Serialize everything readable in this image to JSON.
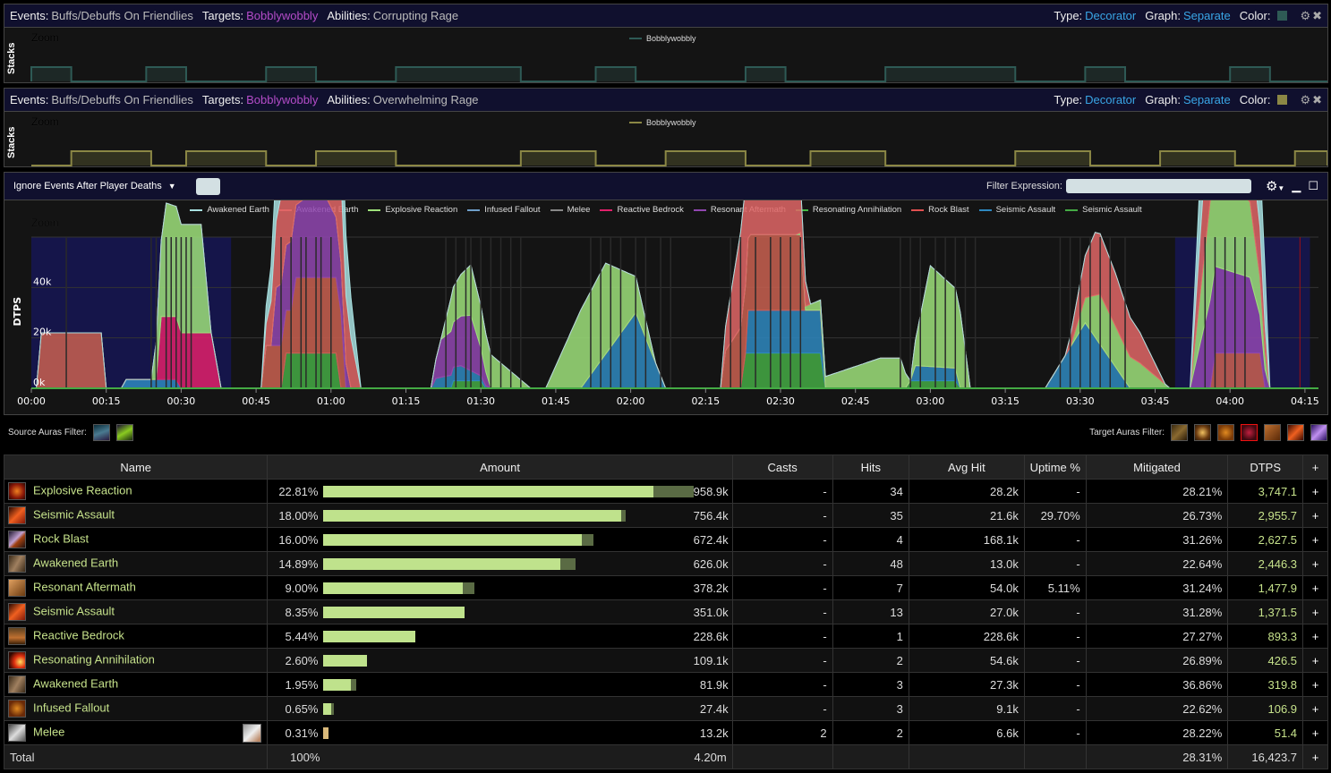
{
  "decorators": [
    {
      "events_label": "Events:",
      "events_value": "Buffs/Debuffs On Friendlies",
      "targets_label": "Targets:",
      "targets_value": "Bobblywobbly",
      "abilities_label": "Abilities:",
      "abilities_value": "Corrupting Rage",
      "type_label": "Type:",
      "type_value": "Decorator",
      "graph_label": "Graph:",
      "graph_value": "Separate",
      "color_label": "Color:",
      "color": "#2e5a55",
      "zoom_label": "Zoom",
      "ylabel": "Stacks",
      "legend": "Bobblywobbly",
      "active_intervals_s": [
        [
          0,
          8
        ],
        [
          23,
          31
        ],
        [
          47,
          57
        ],
        [
          73,
          98
        ],
        [
          113,
          121
        ],
        [
          143,
          151
        ],
        [
          171,
          197
        ],
        [
          211,
          219
        ],
        [
          240,
          248
        ]
      ]
    },
    {
      "events_label": "Events:",
      "events_value": "Buffs/Debuffs On Friendlies",
      "targets_label": "Targets:",
      "targets_value": "Bobblywobbly",
      "abilities_label": "Abilities:",
      "abilities_value": "Overwhelming Rage",
      "type_label": "Type:",
      "type_value": "Decorator",
      "graph_label": "Graph:",
      "graph_value": "Separate",
      "color_label": "Color:",
      "color": "#8b8745",
      "zoom_label": "Zoom",
      "ylabel": "Stacks",
      "legend": "Bobblywobbly",
      "active_intervals_s": [
        [
          8,
          24
        ],
        [
          31,
          47
        ],
        [
          57,
          73
        ],
        [
          98,
          113
        ],
        [
          127,
          143
        ],
        [
          156,
          171
        ],
        [
          197,
          212
        ],
        [
          226,
          241
        ],
        [
          253,
          262
        ]
      ]
    }
  ],
  "main_toolbar": {
    "death_filter": "Ignore Events After Player Deaths",
    "filter_label": "Filter Expression:",
    "filter_value": ""
  },
  "chart_data": {
    "type": "area",
    "stacked": true,
    "zoom_label": "Zoom",
    "ylabel": "DTPS",
    "xlabel": "",
    "ylim": [
      0,
      60000
    ],
    "yticks": [
      "0k",
      "20k",
      "40k"
    ],
    "xticks": [
      "00:00",
      "00:15",
      "00:30",
      "00:45",
      "01:00",
      "01:15",
      "01:30",
      "01:45",
      "02:00",
      "02:15",
      "02:30",
      "02:45",
      "03:00",
      "03:15",
      "03:30",
      "03:45",
      "04:00",
      "04:15"
    ],
    "xlim_s": [
      0,
      256
    ],
    "highlight_ranges_s": [
      [
        0,
        40
      ],
      [
        229,
        256
      ]
    ],
    "legend": [
      "Awakened Earth",
      "Awakened Earth",
      "Explosive Reaction",
      "Infused Fallout",
      "Melee",
      "Reactive Bedrock",
      "Resonant Aftermath",
      "Resonating Annihilation",
      "Rock Blast",
      "Seismic Assault",
      "Seismic Assault"
    ],
    "series_colors": [
      "#a8e0e0",
      "#e06666",
      "#9ee07a",
      "#6e9ec8",
      "#888888",
      "#e0206a",
      "#9046b0",
      "#44bb44",
      "#e05050",
      "#2e88c0",
      "#44aa44"
    ],
    "series": [
      {
        "name": "Seismic Assault (green)",
        "color": "#44aa44",
        "points": [
          [
            50,
            0
          ],
          [
            51,
            14000
          ],
          [
            61,
            14000
          ],
          [
            62,
            0
          ],
          [
            84,
            0
          ],
          [
            84,
            3000
          ],
          [
            90,
            3000
          ],
          [
            91,
            0
          ],
          [
            142,
            0
          ],
          [
            143,
            14000
          ],
          [
            158,
            14000
          ],
          [
            159,
            0
          ],
          [
            175,
            0
          ],
          [
            176,
            3000
          ],
          [
            185,
            3000
          ],
          [
            186,
            0
          ]
        ]
      },
      {
        "name": "Seismic Assault (blue)",
        "color": "#2e88c0",
        "points": [
          [
            18,
            0
          ],
          [
            19,
            3500
          ],
          [
            29,
            3500
          ],
          [
            30,
            0
          ],
          [
            80,
            0
          ],
          [
            81,
            4000
          ],
          [
            86,
            6000
          ],
          [
            92,
            0
          ],
          [
            110,
            0
          ],
          [
            121,
            30000
          ],
          [
            127,
            0
          ],
          [
            143,
            0
          ],
          [
            143,
            17000
          ],
          [
            158,
            17000
          ],
          [
            159,
            0
          ],
          [
            176,
            0
          ],
          [
            177,
            6000
          ],
          [
            185,
            5000
          ],
          [
            186,
            0
          ],
          [
            203,
            0
          ],
          [
            211,
            26000
          ],
          [
            220,
            0
          ]
        ]
      },
      {
        "name": "Reactive Bedrock",
        "color": "#e0206a",
        "points": [
          [
            25,
            0
          ],
          [
            26,
            25000
          ],
          [
            29,
            25000
          ],
          [
            30,
            22000
          ],
          [
            36,
            22000
          ],
          [
            38,
            0
          ]
        ]
      },
      {
        "name": "Rock Blast",
        "color": "#c96050",
        "points": [
          [
            1,
            0
          ],
          [
            2,
            22000
          ],
          [
            14,
            22000
          ],
          [
            15,
            0
          ],
          [
            46,
            0
          ],
          [
            47,
            17000
          ],
          [
            52,
            17000
          ],
          [
            53,
            30000
          ],
          [
            62,
            30000
          ],
          [
            63,
            0
          ],
          [
            138,
            0
          ],
          [
            139,
            15000
          ],
          [
            144,
            30000
          ],
          [
            154,
            30000
          ],
          [
            155,
            0
          ],
          [
            236,
            0
          ],
          [
            237,
            14000
          ],
          [
            246,
            14000
          ],
          [
            247,
            0
          ]
        ]
      },
      {
        "name": "Resonant Aftermath",
        "color": "#9046b0",
        "points": [
          [
            48,
            0
          ],
          [
            49,
            23000
          ],
          [
            58,
            36000
          ],
          [
            62,
            20000
          ],
          [
            64,
            0
          ],
          [
            80,
            0
          ],
          [
            82,
            15000
          ],
          [
            88,
            22000
          ],
          [
            92,
            0
          ],
          [
            232,
            0
          ],
          [
            236,
            35000
          ],
          [
            244,
            30000
          ],
          [
            248,
            0
          ]
        ]
      },
      {
        "name": "Explosive Reaction",
        "color": "#9ee07a",
        "points": [
          [
            24,
            0
          ],
          [
            27,
            45000
          ],
          [
            30,
            43000
          ],
          [
            34,
            43000
          ],
          [
            36,
            0
          ],
          [
            82,
            0
          ],
          [
            84,
            13000
          ],
          [
            88,
            20000
          ],
          [
            100,
            0
          ],
          [
            103,
            0
          ],
          [
            110,
            31000
          ],
          [
            115,
            36000
          ],
          [
            120,
            18000
          ],
          [
            125,
            0
          ],
          [
            153,
            0
          ],
          [
            158,
            4000
          ],
          [
            170,
            12000
          ],
          [
            174,
            12000
          ],
          [
            176,
            0
          ],
          [
            176,
            0
          ],
          [
            180,
            40000
          ],
          [
            186,
            30000
          ],
          [
            188,
            0
          ],
          [
            208,
            0
          ],
          [
            214,
            20000
          ],
          [
            222,
            10000
          ],
          [
            228,
            0
          ],
          [
            232,
            0
          ],
          [
            236,
            39000
          ],
          [
            244,
            30000
          ],
          [
            248,
            0
          ]
        ]
      },
      {
        "name": "Awakened Earth (red)",
        "color": "#e06666",
        "points": [
          [
            46,
            0
          ],
          [
            50,
            35000
          ],
          [
            53,
            48000
          ],
          [
            60,
            47000
          ],
          [
            64,
            20000
          ],
          [
            66,
            0
          ],
          [
            138,
            0
          ],
          [
            142,
            38000
          ],
          [
            148,
            43000
          ],
          [
            150,
            25000
          ],
          [
            154,
            20000
          ],
          [
            156,
            0
          ],
          [
            207,
            0
          ],
          [
            213,
            25000
          ],
          [
            217,
            21000
          ],
          [
            222,
            12000
          ],
          [
            227,
            0
          ],
          [
            232,
            0
          ],
          [
            236,
            45000
          ],
          [
            240,
            38000
          ],
          [
            246,
            20000
          ],
          [
            248,
            0
          ]
        ]
      },
      {
        "name": "Awakened Earth (cyan)",
        "color": "#a8e0e0",
        "points": [
          [
            46,
            0
          ],
          [
            53,
            49000
          ],
          [
            60,
            48000
          ],
          [
            66,
            0
          ],
          [
            232,
            0
          ],
          [
            236,
            48000
          ],
          [
            242,
            45000
          ],
          [
            247,
            22000
          ],
          [
            248,
            0
          ]
        ]
      }
    ]
  },
  "source_auras": {
    "label": "Source Auras Filter:",
    "icons": [
      "aura-icon-1",
      "aura-icon-2"
    ]
  },
  "target_auras": {
    "label": "Target Auras Filter:",
    "icons": [
      "aura-icon-1",
      "aura-icon-2",
      "aura-icon-3",
      "aura-icon-4",
      "aura-icon-5",
      "aura-icon-6",
      "aura-icon-7"
    ],
    "selected_index": 3
  },
  "table": {
    "headers": [
      "Name",
      "Amount",
      "Casts",
      "Hits",
      "Avg Hit",
      "Uptime %",
      "Mitigated",
      "DTPS",
      "+"
    ],
    "rows": [
      {
        "name": "Explosive Reaction",
        "icon": "explosive-reaction-icon",
        "pct": "22.81%",
        "fill": 0.858,
        "overkill": 0.103,
        "amount": "958.9k",
        "casts": "-",
        "hits": "34",
        "avg": "28.2k",
        "uptime": "-",
        "mitigated": "28.21%",
        "dtps": "3,747.1"
      },
      {
        "name": "Seismic Assault",
        "icon": "seismic-assault-icon",
        "pct": "18.00%",
        "fill": 0.774,
        "overkill": 0.012,
        "amount": "756.4k",
        "casts": "-",
        "hits": "35",
        "avg": "21.6k",
        "uptime": "29.70%",
        "mitigated": "26.73%",
        "dtps": "2,955.7"
      },
      {
        "name": "Rock Blast",
        "icon": "rock-blast-icon",
        "pct": "16.00%",
        "fill": 0.671,
        "overkill": 0.031,
        "amount": "672.4k",
        "casts": "-",
        "hits": "4",
        "avg": "168.1k",
        "uptime": "-",
        "mitigated": "31.26%",
        "dtps": "2,627.5"
      },
      {
        "name": "Awakened Earth",
        "icon": "awakened-earth-icon",
        "pct": "14.89%",
        "fill": 0.616,
        "overkill": 0.038,
        "amount": "626.0k",
        "casts": "-",
        "hits": "48",
        "avg": "13.0k",
        "uptime": "-",
        "mitigated": "22.64%",
        "dtps": "2,446.3"
      },
      {
        "name": "Resonant Aftermath",
        "icon": "resonant-aftermath-icon",
        "pct": "9.00%",
        "fill": 0.361,
        "overkill": 0.032,
        "amount": "378.2k",
        "casts": "-",
        "hits": "7",
        "avg": "54.0k",
        "uptime": "5.11%",
        "mitigated": "31.24%",
        "dtps": "1,477.9"
      },
      {
        "name": "Seismic Assault",
        "icon": "seismic-assault-icon",
        "pct": "8.35%",
        "fill": 0.366,
        "overkill": 0,
        "amount": "351.0k",
        "casts": "-",
        "hits": "13",
        "avg": "27.0k",
        "uptime": "-",
        "mitigated": "31.28%",
        "dtps": "1,371.5"
      },
      {
        "name": "Reactive Bedrock",
        "icon": "reactive-bedrock-icon",
        "pct": "5.44%",
        "fill": 0.238,
        "overkill": 0,
        "amount": "228.6k",
        "casts": "-",
        "hits": "1",
        "avg": "228.6k",
        "uptime": "-",
        "mitigated": "27.27%",
        "dtps": "893.3"
      },
      {
        "name": "Resonating Annihilation",
        "icon": "resonating-annihilation-icon",
        "pct": "2.60%",
        "fill": 0.114,
        "overkill": 0,
        "amount": "109.1k",
        "casts": "-",
        "hits": "2",
        "avg": "54.6k",
        "uptime": "-",
        "mitigated": "26.89%",
        "dtps": "426.5"
      },
      {
        "name": "Awakened Earth",
        "icon": "awakened-earth-icon",
        "pct": "1.95%",
        "fill": 0.072,
        "overkill": 0.012,
        "amount": "81.9k",
        "casts": "-",
        "hits": "3",
        "avg": "27.3k",
        "uptime": "-",
        "mitigated": "36.86%",
        "dtps": "319.8"
      },
      {
        "name": "Infused Fallout",
        "icon": "infused-fallout-icon",
        "pct": "0.65%",
        "fill": 0.02,
        "overkill": 0.008,
        "amount": "27.4k",
        "casts": "-",
        "hits": "3",
        "avg": "9.1k",
        "uptime": "-",
        "mitigated": "22.62%",
        "dtps": "106.9"
      },
      {
        "name": "Melee",
        "icon": "melee-icon",
        "pct": "0.31%",
        "fill": 0.012,
        "overkill": 0,
        "amount": "13.2k",
        "casts": "2",
        "hits": "2",
        "avg": "6.6k",
        "uptime": "-",
        "mitigated": "28.22%",
        "dtps": "51.4",
        "melee": true
      }
    ],
    "total": {
      "name": "Total",
      "pct": "100%",
      "amount": "4.20m",
      "mitigated": "28.31%",
      "dtps": "16,423.7"
    }
  }
}
